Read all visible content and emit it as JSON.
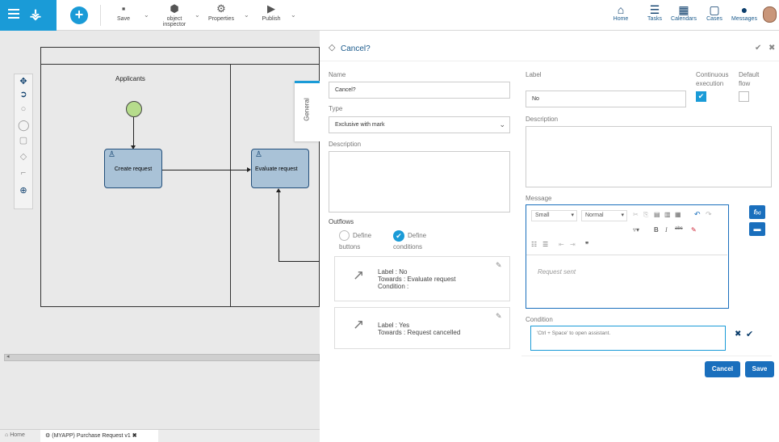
{
  "toolbar": {
    "save_label": "Save",
    "object_inspector_label_line1": "object",
    "object_inspector_label_line2": "inspector",
    "properties_label": "Properties",
    "publish_label": "Publish"
  },
  "nav": {
    "home": "Home",
    "tasks": "Tasks",
    "calendars": "Calendars",
    "cases": "Cases",
    "messages": "Messages"
  },
  "diagram": {
    "lane_label": "Applicants",
    "task1": "Create request",
    "task2": "Evaluate request"
  },
  "side_tab": "General",
  "bottom_tabs": {
    "home": "Home",
    "process_tab": "(MYAPP) Purchase Request v1"
  },
  "panel": {
    "title": "Cancel?",
    "name_label": "Name",
    "name_value": "Cancel?",
    "type_label": "Type",
    "type_value": "Exclusive with mark",
    "description_label": "Description",
    "outflows_label": "Outflows",
    "define_buttons_line1": "Define",
    "define_buttons_line2": "buttons",
    "define_conditions_line1": "Define",
    "define_conditions_line2": "conditions",
    "flows": [
      {
        "label": "Label : No",
        "towards": "Towards : Evaluate request",
        "condition": "Condition :"
      },
      {
        "label": "Label : Yes",
        "towards": "Towards : Request cancelled"
      }
    ],
    "label_label": "Label",
    "label_value": "No",
    "continuous_line1": "Continuous",
    "continuous_line2": "execution",
    "continuous_checked": true,
    "default_line1": "Default",
    "default_line2": "flow",
    "default_checked": false,
    "description2_label": "Description",
    "message_label": "Message",
    "editor": {
      "size_value": "Small",
      "format_value": "Normal",
      "content": "Request sent"
    },
    "condition_label": "Condition",
    "condition_placeholder": "'Ctrl + Space' to open assistant.",
    "cancel_button": "Cancel",
    "save_button": "Save"
  },
  "colors": {
    "accent": "#1a9bd7",
    "brand_dark": "#0b3d6b",
    "button_blue": "#1a6fbd",
    "task_fill": "#a9c2d7",
    "start_event": "#b6dc8c"
  }
}
